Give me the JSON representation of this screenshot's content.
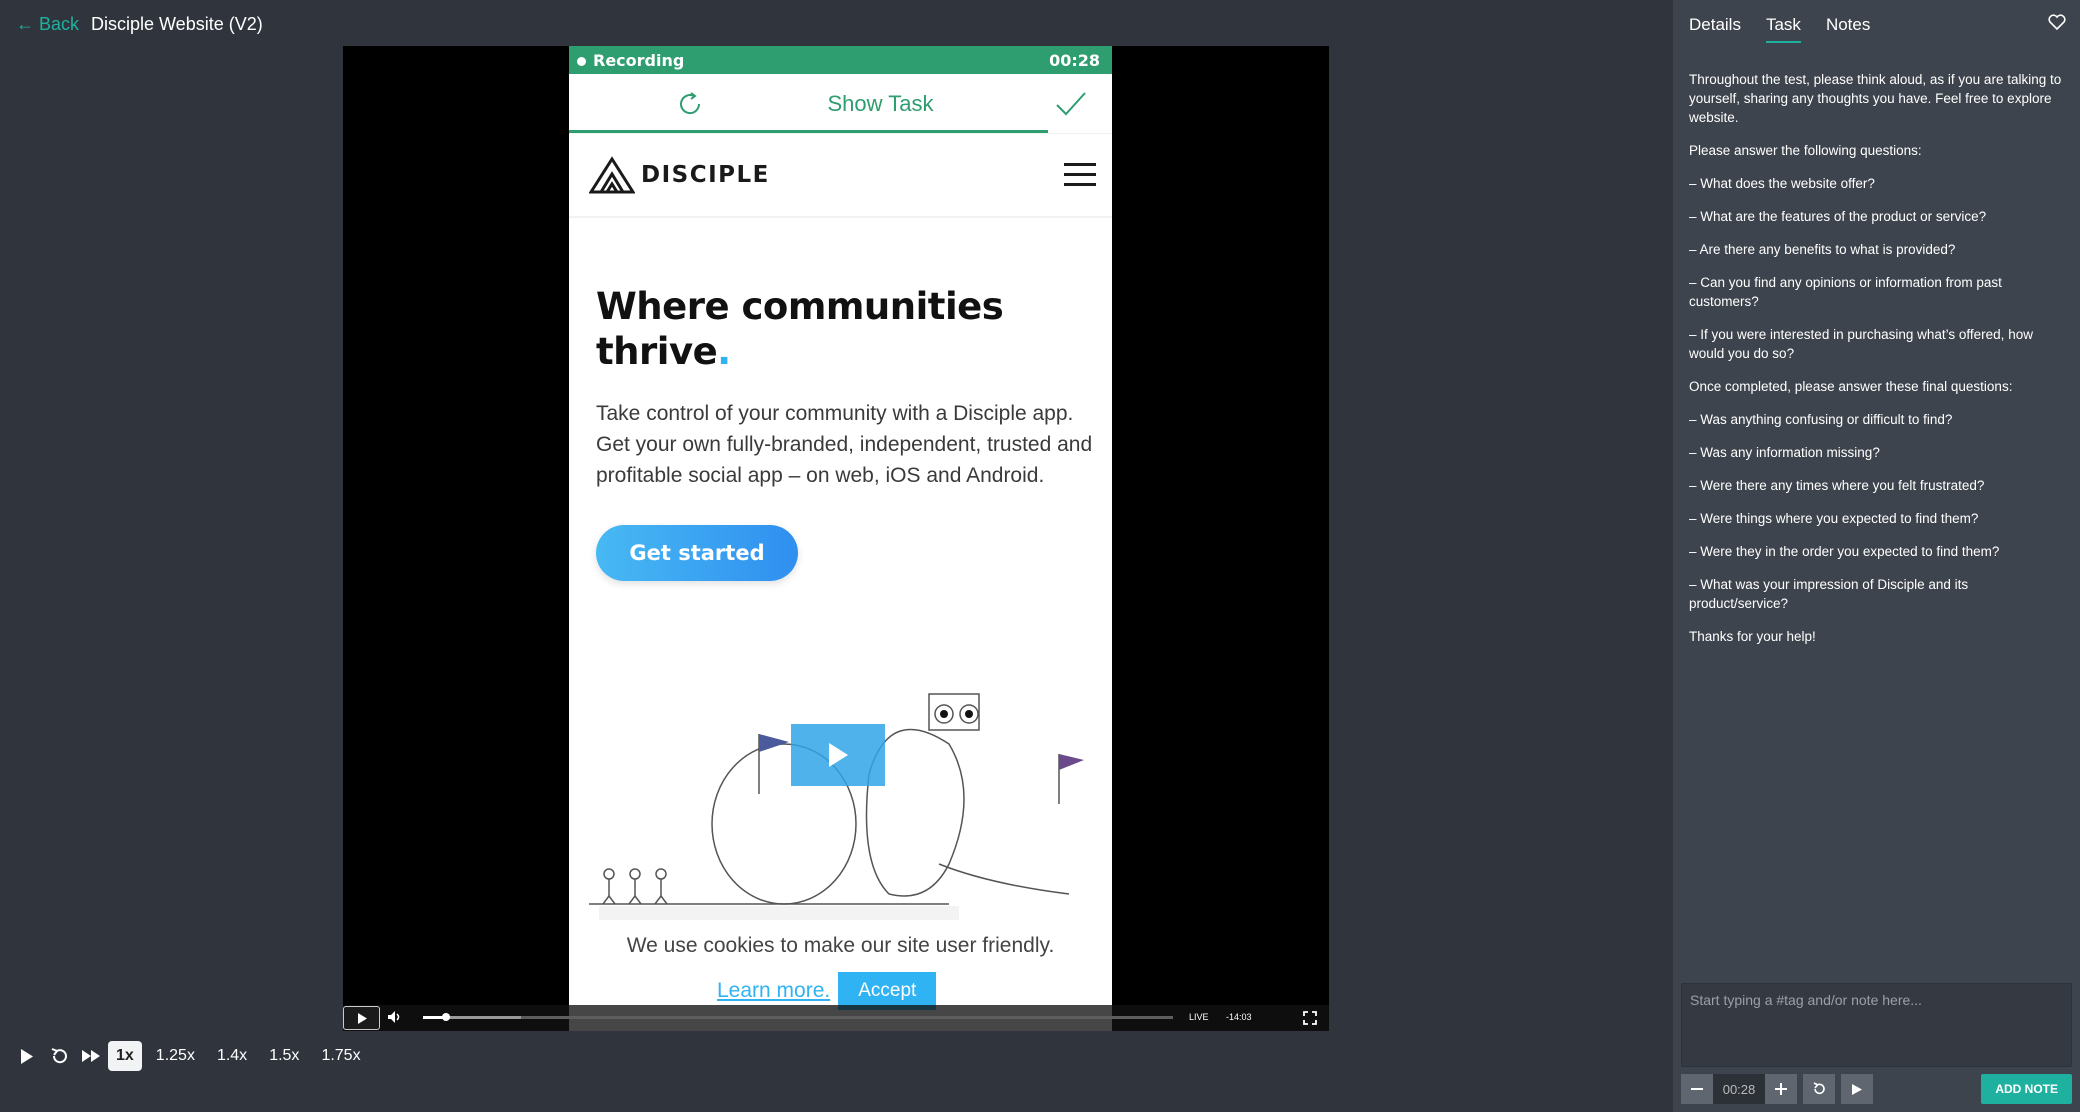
{
  "header": {
    "back_label": "← Back",
    "title": "Disciple Website (V2)"
  },
  "recording": {
    "status": "Recording",
    "time": "00:28",
    "show_task": "Show Task"
  },
  "site": {
    "logo": "DISCIPLE",
    "hero_title": "Where communities thrive",
    "hero_dot": ".",
    "hero_text": "Take control of your community with a Disciple app. Get your own fully-branded, independent, trusted and profitable social app – on web, iOS and Android.",
    "cta": "Get started",
    "cookie_text": "We use cookies to make our site user friendly.",
    "learn_more": "Learn more.",
    "accept": "Accept"
  },
  "player": {
    "live": "LIVE",
    "remaining": "-14:03",
    "progress": 0.03
  },
  "speeds": [
    "1x",
    "1.25x",
    "1.4x",
    "1.5x",
    "1.75x"
  ],
  "panel": {
    "tabs": [
      "Details",
      "Task",
      "Notes"
    ],
    "active_tab": "Task",
    "task": [
      "Throughout the test, please think aloud, as if you are talking to yourself, sharing any thoughts you have. Feel free to explore website.",
      "Please answer the following questions:",
      "– What does the website offer?",
      "– What are the features of the product or service?",
      "– Are there any benefits to what is provided?",
      "– Can you find any opinions or information from past customers?",
      "– If you were interested in purchasing what’s offered, how would you do so?",
      "Once completed, please answer these final questions:",
      "– Was anything confusing or difficult to find?",
      "– Was any information missing?",
      "– Were there any times where you felt frustrated?",
      "– Were things where you expected to find them?",
      "– Were they in the order you expected to find them?",
      "– What was your impression of Disciple and its product/service?",
      "Thanks for your help!"
    ],
    "note_placeholder": "Start typing a #tag and/or note here...",
    "note_time": "00:28",
    "add_note": "ADD NOTE"
  },
  "colors": {
    "accent": "#1fb1a0",
    "recording": "#2e9d6f",
    "brand_blue": "#30b3f2"
  }
}
